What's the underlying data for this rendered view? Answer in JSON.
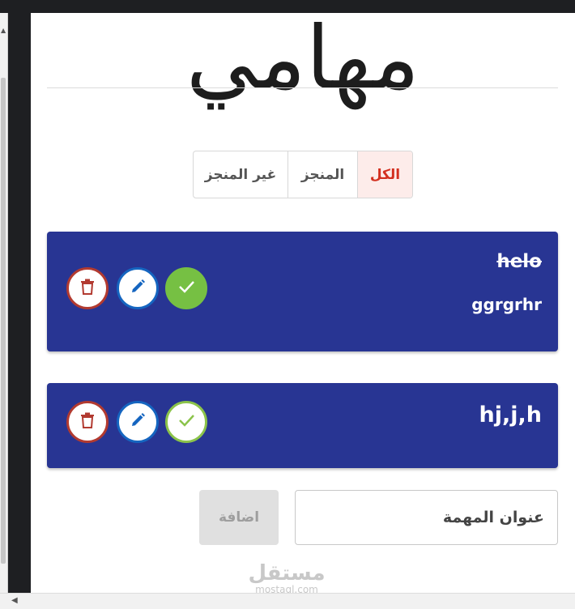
{
  "page": {
    "title": "مهامي"
  },
  "filters": [
    {
      "label": "غير المنجز",
      "active": false
    },
    {
      "label": "المنجز",
      "active": false
    },
    {
      "label": "الكل",
      "active": true
    }
  ],
  "tasks": [
    {
      "title": "helo",
      "details": "ggrgrhr",
      "completed": true
    },
    {
      "title": "hj,j,h",
      "details": "",
      "completed": false
    }
  ],
  "form": {
    "input_placeholder": "عنوان المهمة",
    "input_value": "",
    "add_label": "اضافة"
  },
  "watermark": {
    "logo": "مستقل",
    "url": "mostaql.com"
  },
  "colors": {
    "card_bg": "#283593",
    "active_filter_text": "#d32f1f",
    "active_filter_bg": "#fdecea",
    "delete": "#b23a30",
    "edit": "#1565c0",
    "done": "#76c043"
  }
}
